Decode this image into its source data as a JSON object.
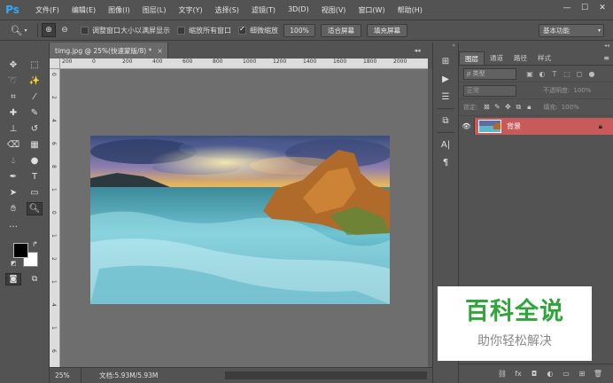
{
  "app": {
    "logo": "Ps"
  },
  "menu": [
    "文件(F)",
    "编辑(E)",
    "图像(I)",
    "图层(L)",
    "文字(Y)",
    "选择(S)",
    "滤镜(T)",
    "3D(D)",
    "视图(V)",
    "窗口(W)",
    "帮助(H)"
  ],
  "window_controls": {
    "minimize": "—",
    "maximize": "☐",
    "close": "✕"
  },
  "options": {
    "tool_icon": "zoom-icon",
    "resize_windows": "调整窗口大小以满屏显示",
    "zoom_all": "缩放所有窗口",
    "scrubby_zoom": "细微缩放",
    "zoom_value": "100%",
    "fit_screen": "适合屏幕",
    "fill_screen": "填充屏幕",
    "workspace": "基本功能",
    "checks": {
      "resize_windows": false,
      "zoom_all": false,
      "scrubby_zoom": true
    }
  },
  "document": {
    "tab_title": "timg.jpg @ 25%(快速蒙版/8) *",
    "close": "×",
    "ruler_h_labels": [
      "200",
      "0",
      "200",
      "400",
      "600",
      "800",
      "1000",
      "1200",
      "1400",
      "1600",
      "1800",
      "2000"
    ],
    "ruler_v_labels": [
      "0",
      "2",
      "4",
      "6",
      "8",
      "1",
      "0",
      "1",
      "2",
      "1",
      "4",
      "1",
      "6"
    ],
    "status_zoom": "25%",
    "status_doc": "文档:5.93M/5.93M"
  },
  "layers_panel": {
    "tabs": [
      "图层",
      "通道",
      "路径",
      "样式"
    ],
    "filter_placeholder": "ρ 类型",
    "blend_mode": "正常",
    "opacity_label": "不透明度:",
    "opacity_value": "100%",
    "lock_label": "锁定:",
    "fill_label": "填充:",
    "fill_value": "100%",
    "layers": [
      {
        "name": "背景",
        "visible": true,
        "locked": true
      }
    ]
  },
  "watermark": {
    "title": "百科全说",
    "subtitle": "助你轻松解决"
  },
  "colors": {
    "accent_layer": "#c85a5a",
    "watermark_green": "#2ea63a",
    "ui_bg": "#535353"
  }
}
